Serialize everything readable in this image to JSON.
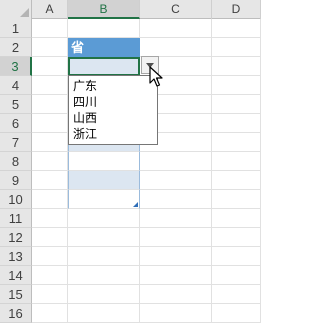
{
  "columns": [
    "A",
    "B",
    "C",
    "D"
  ],
  "selected_column": "B",
  "rows": [
    "1",
    "2",
    "3",
    "4",
    "5",
    "6",
    "7",
    "8",
    "9",
    "10",
    "11",
    "12",
    "13",
    "14",
    "15",
    "16"
  ],
  "selected_row": "3",
  "table": {
    "header": "省",
    "selected_cell": "B3"
  },
  "dropdown": {
    "options": [
      "广东",
      "四川",
      "山西",
      "浙江"
    ]
  },
  "colors": {
    "table_header": "#5b9bd5",
    "band": "#dce6f1",
    "selection": "#217346"
  }
}
